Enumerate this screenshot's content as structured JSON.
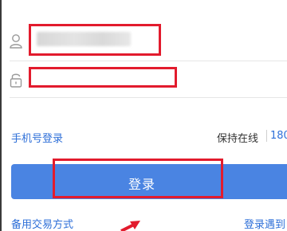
{
  "login_form": {
    "account_value": "",
    "account_placeholder": "",
    "password_placeholder": ""
  },
  "options": {
    "phone_login": "手机号登录",
    "stay_online_label": "保持在线",
    "stay_online_value": "180"
  },
  "login_button": {
    "label": "登录"
  },
  "footer": {
    "backup_trade": "备用交易方式",
    "login_issue": "登录遇到"
  },
  "colors": {
    "accent_blue": "#4a84e2",
    "link_blue": "#2e6fd8",
    "annotation_red": "#e21b2d"
  },
  "icons": {
    "account": "user-icon",
    "password": "lock-icon",
    "annotation": "arrow-icon"
  }
}
